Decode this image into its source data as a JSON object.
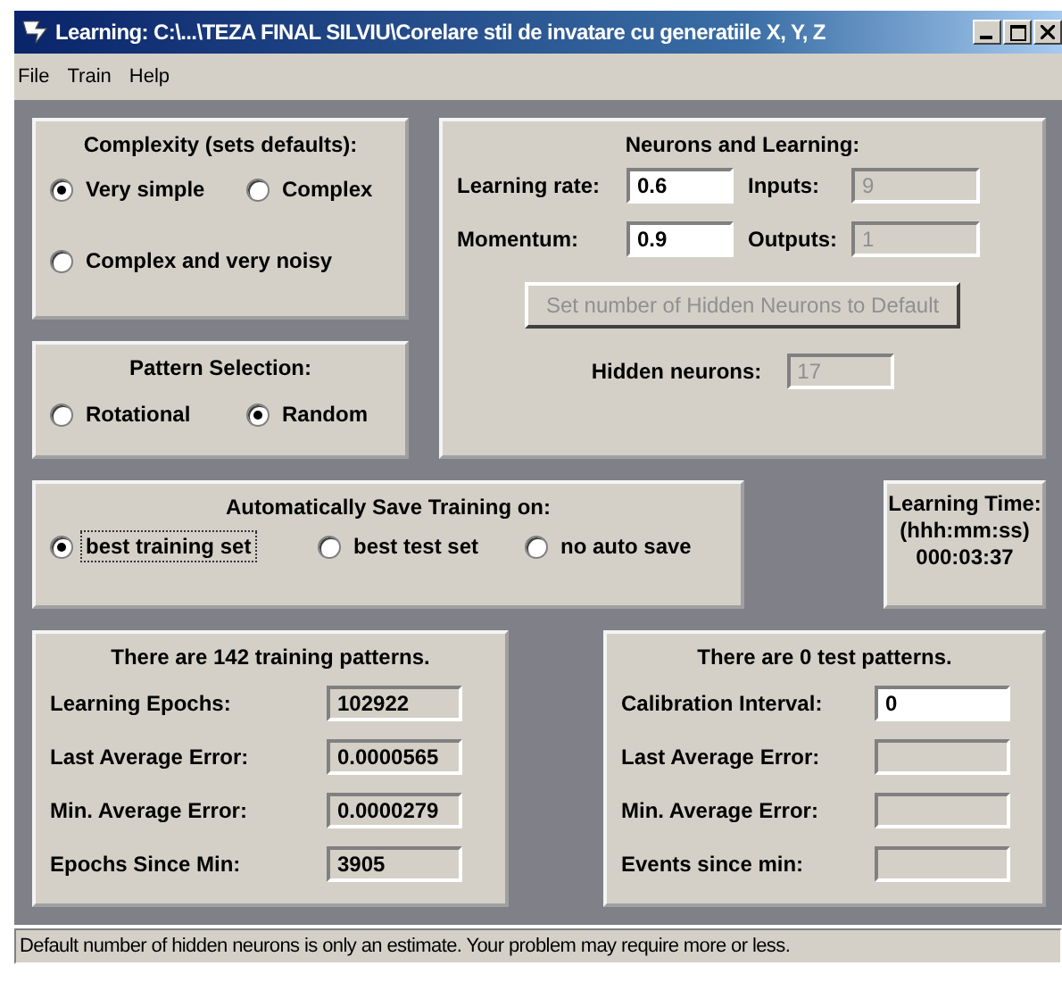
{
  "window": {
    "title": "Learning: C:\\...\\TEZA FINAL SILVIU\\Corelare stil de invatare cu generatiile X, Y, Z"
  },
  "menu": [
    "File",
    "Train",
    "Help"
  ],
  "complexity": {
    "title": "Complexity (sets defaults):",
    "options": [
      {
        "label": "Very simple",
        "selected": true
      },
      {
        "label": "Complex",
        "selected": false
      },
      {
        "label": "Complex and very noisy",
        "selected": false
      }
    ]
  },
  "pattern_selection": {
    "title": "Pattern Selection:",
    "options": [
      {
        "label": "Rotational",
        "selected": false
      },
      {
        "label": "Random",
        "selected": true
      }
    ]
  },
  "neurons": {
    "title": "Neurons and Learning:",
    "fields": [
      {
        "label": "Learning rate:",
        "value": "0.6",
        "disabled": false
      },
      {
        "label": "Inputs:",
        "value": "9",
        "disabled": true
      },
      {
        "label": "Momentum:",
        "value": "0.9",
        "disabled": false
      },
      {
        "label": "Outputs:",
        "value": "1",
        "disabled": true
      }
    ],
    "default_button": {
      "label": "Set number of  Hidden Neurons to Default",
      "disabled": true
    },
    "hidden_neurons": {
      "label": "Hidden neurons:",
      "value": "17",
      "disabled": true
    }
  },
  "auto_save": {
    "title": "Automatically Save Training on:",
    "options": [
      {
        "label": "best training set",
        "selected": true,
        "focused": true
      },
      {
        "label": "best test set",
        "selected": false,
        "focused": false
      },
      {
        "label": "no auto save",
        "selected": false,
        "focused": false
      }
    ]
  },
  "learning_time": {
    "title": "Learning Time:",
    "format": "(hhh:mm:ss)",
    "value": "000:03:37"
  },
  "training": {
    "title": "There are 142 training patterns.",
    "fields": [
      {
        "label": "Learning Epochs:",
        "value": "102922",
        "disabled": true
      },
      {
        "label": "Last Average Error:",
        "value": "0.0000565",
        "disabled": true
      },
      {
        "label": "Min. Average Error:",
        "value": "0.0000279",
        "disabled": true
      },
      {
        "label": "Epochs Since Min:",
        "value": "3905",
        "disabled": true
      }
    ]
  },
  "test": {
    "title": "There are 0 test patterns.",
    "fields": [
      {
        "label": "Calibration Interval:",
        "value": "0",
        "disabled": false
      },
      {
        "label": "Last Average Error:",
        "disabled": true
      },
      {
        "label": "Min. Average Error:",
        "disabled": true
      },
      {
        "label": "Events since min:",
        "disabled": true
      }
    ]
  },
  "status_bar": "Default number of hidden neurons is only an estimate. Your problem may require more or less."
}
